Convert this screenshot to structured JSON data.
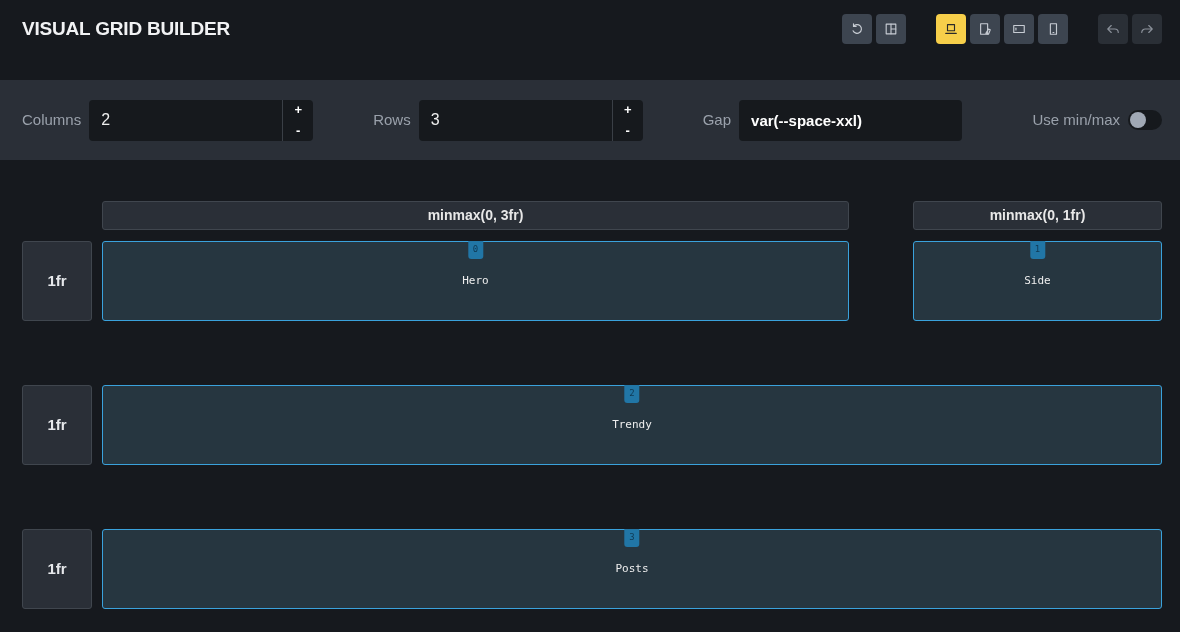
{
  "app_title": "VISUAL GRID BUILDER",
  "toolbar": [
    {
      "selected": false,
      "disabled": false
    },
    {
      "selected": false,
      "disabled": false
    },
    {
      "selected": true,
      "disabled": false
    },
    {
      "selected": false,
      "disabled": false
    },
    {
      "selected": false,
      "disabled": false
    },
    {
      "selected": false,
      "disabled": false
    },
    {
      "selected": false,
      "disabled": true
    },
    {
      "selected": false,
      "disabled": true
    }
  ],
  "controls": {
    "columns": {
      "label": "Columns",
      "value": "2",
      "plus": "+",
      "minus": "-"
    },
    "rows": {
      "label": "Rows",
      "value": "3",
      "plus": "+",
      "minus": "-"
    },
    "gap": {
      "label": "Gap",
      "value": "var(--space-xxl)"
    },
    "minmax": {
      "label": "Use min/max",
      "on": false
    }
  },
  "grid": {
    "columns": [
      {
        "label": "minmax(0, 3fr)"
      },
      {
        "label": "minmax(0, 1fr)"
      }
    ],
    "rows": [
      {
        "label": "1fr"
      },
      {
        "label": "1fr"
      },
      {
        "label": "1fr"
      }
    ],
    "areas": [
      {
        "index": "0",
        "name": "Hero",
        "kind": "cell"
      },
      {
        "index": "1",
        "name": "Side",
        "kind": "cell"
      },
      {
        "index": "2",
        "name": "Trendy",
        "kind": "full-row"
      },
      {
        "index": "3",
        "name": "Posts",
        "kind": "full-row"
      }
    ]
  }
}
